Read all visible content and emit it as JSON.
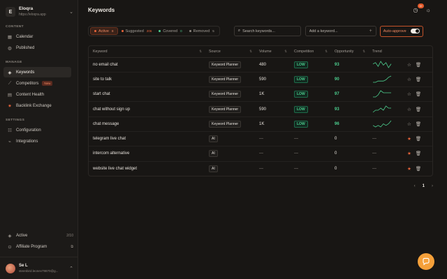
{
  "brand": {
    "initial": "E",
    "name": "Eloqra",
    "url": "https://eloqra.app"
  },
  "sidebar": {
    "content_label": "CONTENT",
    "content_items": [
      {
        "label": "Calendar",
        "icon": "calendar-icon"
      },
      {
        "label": "Published",
        "icon": "globe-icon"
      }
    ],
    "manage_label": "MANAGE",
    "manage_items": [
      {
        "label": "Keywords",
        "icon": "tag-icon"
      },
      {
        "label": "Competitors",
        "icon": "chart-icon",
        "badge": "New"
      },
      {
        "label": "Content Health",
        "icon": "document-icon"
      },
      {
        "label": "Backlink Exchange",
        "icon": "link-icon"
      }
    ],
    "settings_label": "SETTINGS",
    "settings_items": [
      {
        "label": "Configuration",
        "icon": "gear-icon"
      },
      {
        "label": "Integrations",
        "icon": "plug-icon"
      }
    ],
    "active_label": "Active",
    "active_count": "2/10",
    "affiliate_label": "Affiliate Program",
    "user_name": "Se L",
    "user_email": "steenbird.leonev79870@g..."
  },
  "header": {
    "title": "Keywords",
    "notif_count": "9+"
  },
  "filters": [
    {
      "label": "Active",
      "count": "8",
      "color": "#e8643a"
    },
    {
      "label": "Suggested",
      "count": "206",
      "color": "#e8643a"
    },
    {
      "label": "Covered",
      "count": "0",
      "color": "#4ccf8f"
    },
    {
      "label": "Removed",
      "count": "5",
      "color": "#8b857e"
    }
  ],
  "search": {
    "placeholder": "Search keywords..."
  },
  "add": {
    "placeholder": "Add a keyword..."
  },
  "auto_approve_label": "Auto-approve",
  "columns": {
    "keyword": "Keyword",
    "source": "Source",
    "volume": "Volume",
    "competition": "Competition",
    "opportunity": "Opportunity",
    "trend": "Trend"
  },
  "rows": [
    {
      "keyword": "no email chat",
      "source": "Keyword Planner",
      "volume": "480",
      "competition": "LOW",
      "opportunity": "93",
      "trend": [
        4,
        5,
        2,
        6,
        3,
        5,
        1,
        4
      ],
      "starred": false
    },
    {
      "keyword": "site to talk",
      "source": "Keyword Planner",
      "volume": "590",
      "competition": "LOW",
      "opportunity": "90",
      "trend": [
        1,
        1,
        2,
        2,
        2,
        3,
        5,
        6
      ],
      "starred": false
    },
    {
      "keyword": "start chat",
      "source": "Keyword Planner",
      "volume": "1K",
      "competition": "LOW",
      "opportunity": "97",
      "trend": [
        2,
        2,
        3,
        5,
        4,
        4,
        4,
        4
      ],
      "starred": false
    },
    {
      "keyword": "chat without sign up",
      "source": "Keyword Planner",
      "volume": "590",
      "competition": "LOW",
      "opportunity": "93",
      "trend": [
        1,
        2,
        2,
        3,
        2,
        4,
        3,
        3
      ],
      "starred": false
    },
    {
      "keyword": "chat message",
      "source": "Keyword Planner",
      "volume": "1K",
      "competition": "LOW",
      "opportunity": "96",
      "trend": [
        3,
        2,
        3,
        2,
        4,
        3,
        4,
        6
      ],
      "starred": false
    },
    {
      "keyword": "telegram live chat",
      "source": "AI",
      "volume": "—",
      "competition": "—",
      "opportunity": "0",
      "trend_text": "—",
      "starred": true
    },
    {
      "keyword": "intercom alternative",
      "source": "AI",
      "volume": "—",
      "competition": "—",
      "opportunity": "0",
      "trend_text": "—",
      "starred": true
    },
    {
      "keyword": "website live chat widget",
      "source": "AI",
      "volume": "—",
      "competition": "—",
      "opportunity": "0",
      "trend_text": "—",
      "starred": true
    }
  ],
  "pager": {
    "prev": "‹",
    "current": "1",
    "next": "›"
  },
  "colors": {
    "accent": "#e8643a",
    "success": "#4ccf8f",
    "fab": "#f5a03a"
  }
}
